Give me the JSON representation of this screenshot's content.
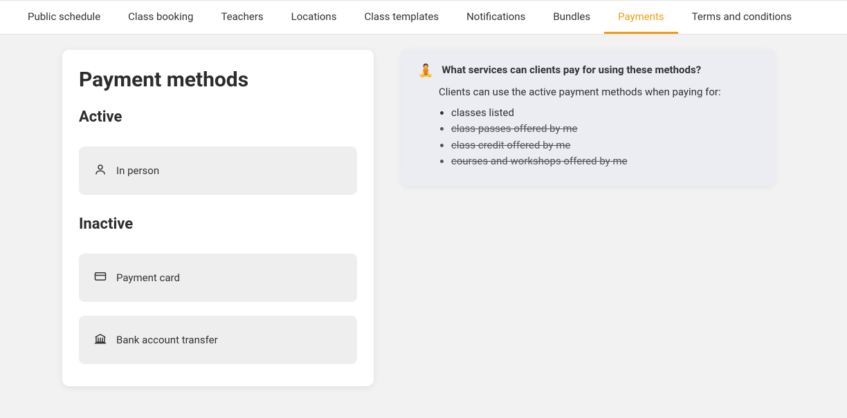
{
  "nav": {
    "items": [
      {
        "label": "Public schedule",
        "active": false
      },
      {
        "label": "Class booking",
        "active": false
      },
      {
        "label": "Teachers",
        "active": false
      },
      {
        "label": "Locations",
        "active": false
      },
      {
        "label": "Class templates",
        "active": false
      },
      {
        "label": "Notifications",
        "active": false
      },
      {
        "label": "Bundles",
        "active": false
      },
      {
        "label": "Payments",
        "active": true
      },
      {
        "label": "Terms and conditions",
        "active": false
      }
    ]
  },
  "page": {
    "title": "Payment methods",
    "active_label": "Active",
    "inactive_label": "Inactive",
    "active_methods": [
      {
        "name": "In person",
        "icon": "person-icon"
      }
    ],
    "inactive_methods": [
      {
        "name": "Payment card",
        "icon": "card-icon"
      },
      {
        "name": "Bank account transfer",
        "icon": "bank-icon"
      }
    ]
  },
  "info": {
    "emoji": "🧘",
    "title": "What services can clients pay for using these methods?",
    "subtitle": "Clients can use the active payment methods when paying for:",
    "items": [
      {
        "text": "classes listed",
        "struck": false
      },
      {
        "text": "class passes offered by me",
        "struck": true
      },
      {
        "text": "class credit offered by me",
        "struck": true
      },
      {
        "text": "courses and workshops offered by me",
        "struck": true
      }
    ]
  }
}
